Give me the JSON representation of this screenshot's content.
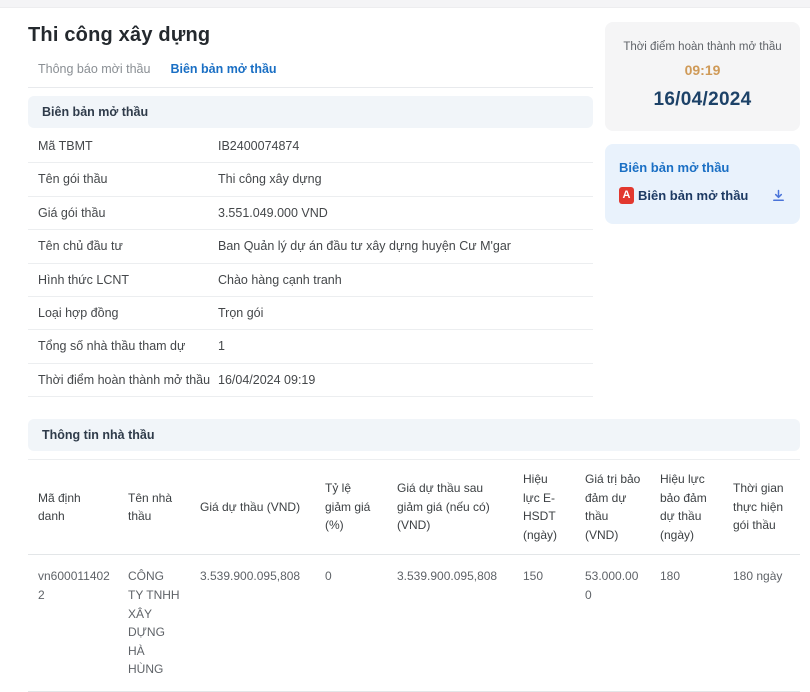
{
  "page": {
    "title": "Thi công xây dựng"
  },
  "tabs": {
    "notice": "Thông báo mời thầu",
    "record": "Biên bản mở thầu"
  },
  "bid_record": {
    "section_title": "Biên bản mở thầu",
    "details": [
      {
        "label": "Mã TBMT",
        "value": "IB2400074874"
      },
      {
        "label": "Tên gói thầu",
        "value": "Thi công xây dựng"
      },
      {
        "label": "Giá gói thầu",
        "value": "3.551.049.000 VND"
      },
      {
        "label": "Tên chủ đầu tư",
        "value": "Ban Quản lý dự án đầu tư xây dựng huyện Cư M'gar"
      },
      {
        "label": "Hình thức LCNT",
        "value": "Chào hàng cạnh tranh"
      },
      {
        "label": "Loại hợp đồng",
        "value": "Trọn gói"
      },
      {
        "label": "Tổng số nhà thầu tham dự",
        "value": "1"
      },
      {
        "label": "Thời điểm hoàn thành mở thầu",
        "value": "16/04/2024 09:19"
      }
    ]
  },
  "sidebar": {
    "completion": {
      "label": "Thời điểm hoàn thành mở thầu",
      "time": "09:19",
      "date": "16/04/2024"
    },
    "document": {
      "title": "Biên bản mở thầu",
      "link_label": "Biên bản mở thầu",
      "pdf_icon": "pdf-file-icon",
      "pdf_glyph": "A",
      "download_icon": "download-icon"
    }
  },
  "contractors": {
    "section_title": "Thông tin nhà thầu",
    "columns": [
      "Mã định danh",
      "Tên nhà thầu",
      "Giá dự thầu (VND)",
      "Tỷ lệ giảm giá (%)",
      "Giá dự thầu sau giảm giá (nếu có) (VND)",
      "Hiệu lực E-HSDT (ngày)",
      "Giá trị bảo đảm dự thầu (VND)",
      "Hiệu lực bảo đảm dự thầu (ngày)",
      "Thời gian thực hiện gói thầu"
    ],
    "rows": [
      [
        "vn6000114022",
        "CÔNG TY TNHH XÂY DỰNG HÀ HÙNG",
        "3.539.900.095,808",
        "0",
        "3.539.900.095,808",
        "150",
        "53.000.000",
        "180",
        "180 ngày"
      ]
    ]
  },
  "colors": {
    "accent_blue": "#1a6fc4",
    "navy": "#1d4268",
    "orange_time": "#cf9a58",
    "pdf_red": "#e2382f",
    "card_gray": "#f5f5f6",
    "card_blue": "#e9f2fc"
  }
}
